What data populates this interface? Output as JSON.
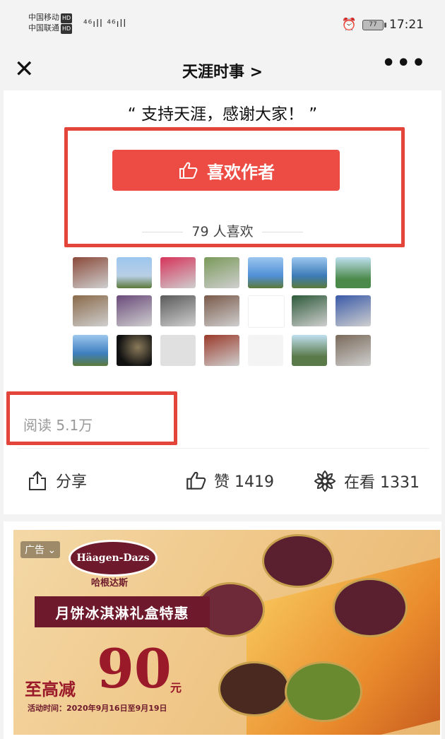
{
  "status_bar": {
    "carrier1": "中国移动",
    "carrier2": "中国联通",
    "hd": "HD",
    "signal_icons": "⁴⁶ıll ⁴⁶ıll",
    "alarm_icon": "⏰",
    "battery": "77",
    "time": "17:21"
  },
  "nav": {
    "close_icon": "✕",
    "title": "天涯时事 >",
    "more_icon": "•••"
  },
  "article_end": {
    "quote": "“ 支持天涯，感谢大家！ ”",
    "like_button_label": "喜欢作者",
    "likes_count": "79 人喜欢",
    "reads": "阅读 5.1万"
  },
  "avatars": [
    {
      "color": "#8a4a3a",
      "type": "flower"
    },
    {
      "color": "#b9cfe6",
      "type": "sky"
    },
    {
      "color": "#d6335a",
      "type": "text"
    },
    {
      "color": "#7a9a5a",
      "type": "person"
    },
    {
      "color": "#4f8fd6",
      "type": "landscape"
    },
    {
      "color": "#3b7bb8",
      "type": "sea"
    },
    {
      "color": "#4c8a4c",
      "type": "forest"
    },
    {
      "color": "#8a6a4a",
      "type": "mountain"
    },
    {
      "color": "#6a4a7a",
      "type": "dusk"
    },
    {
      "color": "#5a5a5a",
      "type": "person"
    },
    {
      "color": "#7a5a4a",
      "type": "couple"
    },
    {
      "color": "#ffffff",
      "type": "logo"
    },
    {
      "color": "#2e5a3a",
      "type": "building"
    },
    {
      "color": "#3a5aa8",
      "type": "person"
    },
    {
      "color": "#3d7fbf",
      "type": "lake"
    },
    {
      "color": "#222222",
      "type": "dark"
    },
    {
      "color": "#e0e0e0",
      "type": "ink"
    },
    {
      "color": "#9a3a2a",
      "type": "temple"
    },
    {
      "color": "#f4f4f4",
      "type": "calligraphy"
    },
    {
      "color": "#5a7a4a",
      "type": "hike"
    },
    {
      "color": "#7a6a5a",
      "type": "family"
    }
  ],
  "actions": {
    "share_label": "分享",
    "like_label": "赞 1419",
    "watching_label": "在看 1331"
  },
  "ad": {
    "tag": "广告 ⌄",
    "brand": "Häagen-Dazs",
    "brand_cn": "哈根达斯",
    "banner_text": "月饼冰淇淋礼盒特惠",
    "promo_prefix": "至高减",
    "promo_amount": "90",
    "promo_unit": "元",
    "promo_date": "活动时间：2020年9月16日至9月19日"
  },
  "colors": {
    "accent": "#ec4c44",
    "highlight": "#e4453a",
    "brand_ad": "#6e1a2c"
  }
}
